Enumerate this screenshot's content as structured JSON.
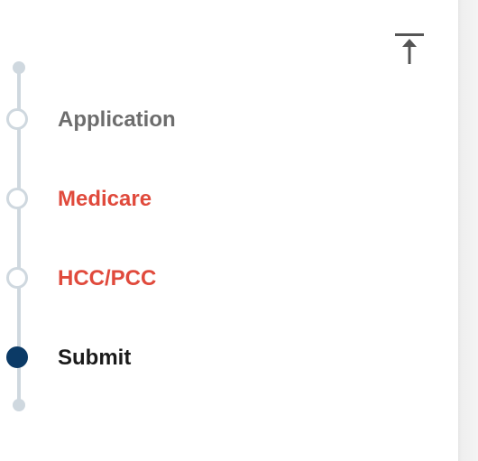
{
  "stepper": {
    "steps": [
      {
        "label": "Application",
        "state": "completed",
        "color": "#6d6d6d"
      },
      {
        "label": "Medicare",
        "state": "error",
        "color": "#e04a3c"
      },
      {
        "label": "HCC/PCC",
        "state": "error",
        "color": "#e04a3c"
      },
      {
        "label": "Submit",
        "state": "active",
        "color": "#1a1a1a"
      }
    ],
    "rail_color": "#cfd8df",
    "active_marker_color": "#0b3a66"
  },
  "toolbar": {
    "scroll_top_icon": "arrow-up-to-line-icon"
  }
}
